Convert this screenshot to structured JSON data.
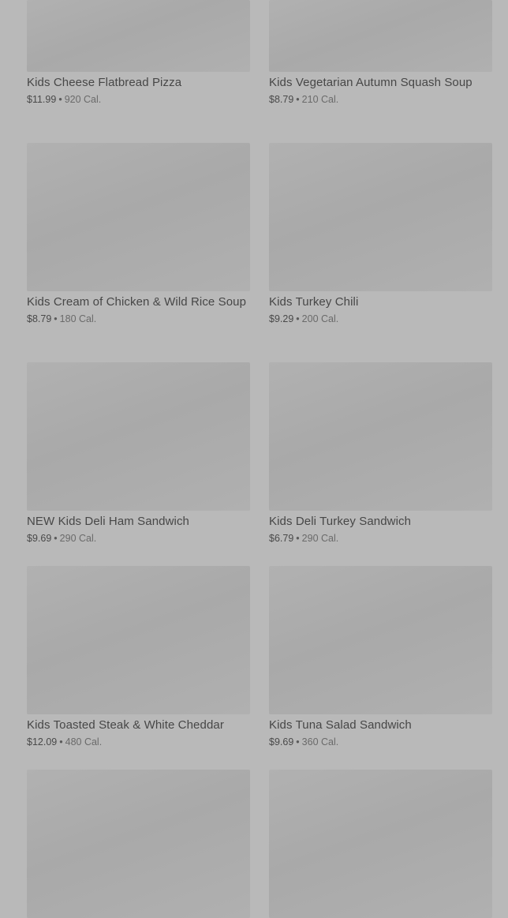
{
  "items": [
    {
      "name": "Kids Cheese Flatbread Pizza",
      "price": "$11.99",
      "calories": "920 Cal."
    },
    {
      "name": "Kids Vegetarian Autumn Squash Soup",
      "price": "$8.79",
      "calories": "210 Cal."
    },
    {
      "name": "Kids Cream of Chicken & Wild Rice Soup",
      "price": "$8.79",
      "calories": "180 Cal."
    },
    {
      "name": "Kids Turkey Chili",
      "price": "$9.29",
      "calories": "200 Cal."
    },
    {
      "name": "NEW Kids Deli Ham Sandwich",
      "price": "$9.69",
      "calories": "290 Cal."
    },
    {
      "name": "Kids Deli Turkey Sandwich",
      "price": "$6.79",
      "calories": "290 Cal."
    },
    {
      "name": "Kids Toasted Steak & White Cheddar",
      "price": "$12.09",
      "calories": "480 Cal."
    },
    {
      "name": "Kids Tuna Salad Sandwich",
      "price": "$9.69",
      "calories": "360 Cal."
    }
  ],
  "separator": "•"
}
